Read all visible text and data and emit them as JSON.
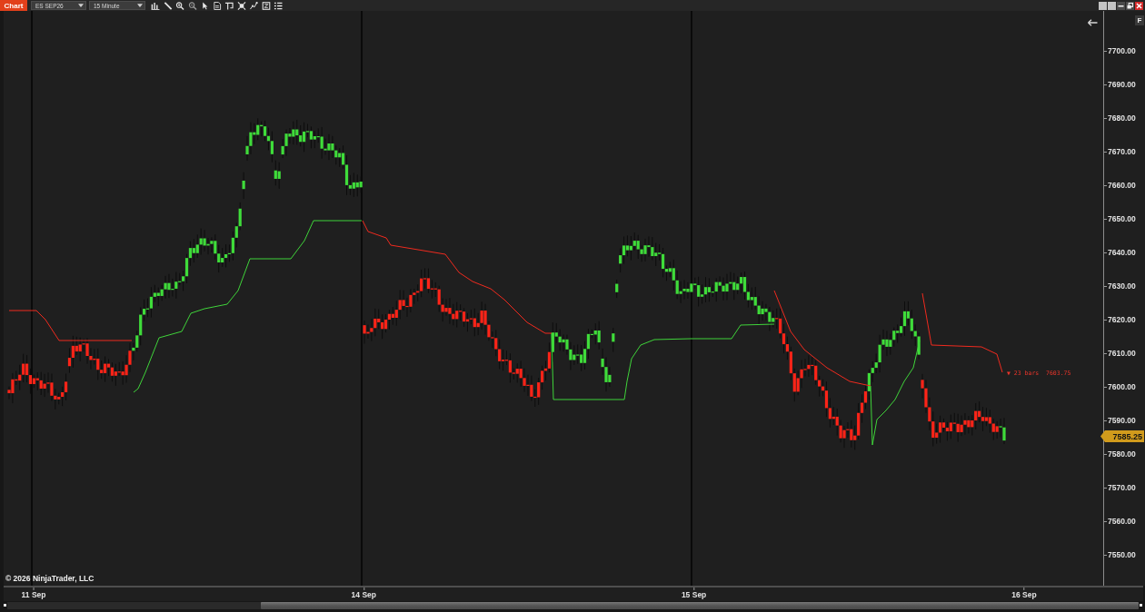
{
  "toolbar": {
    "title": "Chart",
    "instrument": "ES SEP26",
    "interval": "15 Minute"
  },
  "chart": {
    "copyright": "© 2026 NinjaTrader, LLC",
    "stop_label": "▼ 23 bars  7603.75",
    "scale_button": "F",
    "price_axis": [
      "7700.00",
      "7690.00",
      "7680.00",
      "7670.00",
      "7660.00",
      "7650.00",
      "7640.00",
      "7630.00",
      "7620.00",
      "7610.00",
      "7600.00",
      "7590.00",
      "7580.00",
      "7570.00",
      "7560.00",
      "7550.00"
    ],
    "last_price": "7585.25",
    "time_axis": [
      "11 Sep",
      "14 Sep",
      "15 Sep",
      "16 Sep"
    ]
  }
}
